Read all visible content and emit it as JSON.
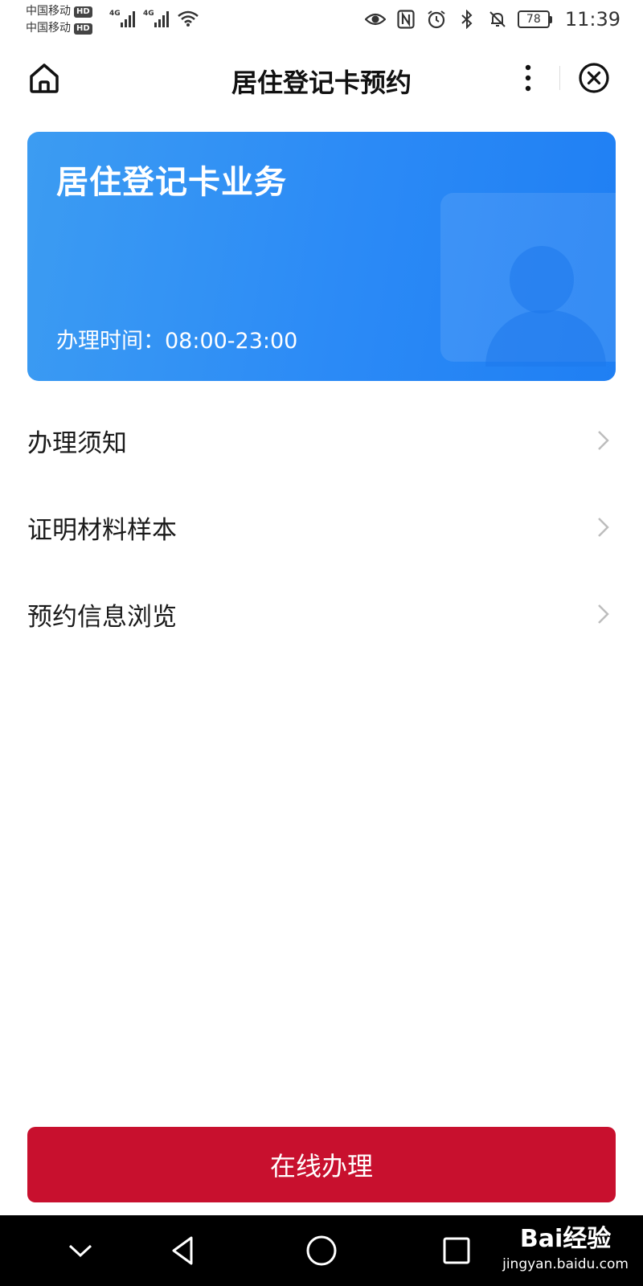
{
  "status_bar": {
    "carrier_1": "中国移动",
    "carrier_2": "中国移动",
    "hd_badge": "HD",
    "network_1": "4G",
    "network_2": "4G",
    "battery": "78",
    "time": "11:39"
  },
  "nav": {
    "title": "居住登记卡预约"
  },
  "banner": {
    "title": "居住登记卡业务",
    "hours": "办理时间：08:00-23:00"
  },
  "menu": {
    "items": [
      {
        "label": "办理须知"
      },
      {
        "label": "证明材料样本"
      },
      {
        "label": "预约信息浏览"
      }
    ]
  },
  "action": {
    "label": "在线办理",
    "color": "#c8102e"
  },
  "watermark": {
    "main": "Bai经验",
    "sub": "jingyan.baidu.com"
  },
  "colors": {
    "banner_start": "#3c9cf2",
    "banner_end": "#1f7ff3",
    "accent_red": "#c8102e"
  },
  "icons": [
    "home-icon",
    "more-icon",
    "close-icon",
    "chevron-right-icon",
    "eye-icon",
    "nfc-icon",
    "alarm-icon",
    "bluetooth-icon",
    "mute-icon",
    "wifi-icon",
    "back-icon",
    "home-circle-icon",
    "recents-icon",
    "down-arrow-icon"
  ]
}
